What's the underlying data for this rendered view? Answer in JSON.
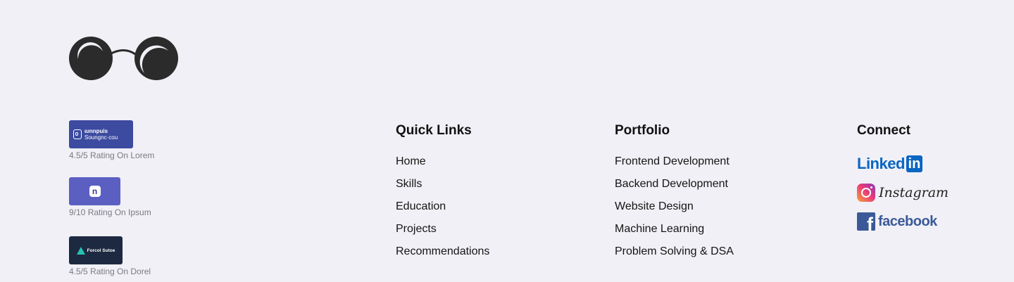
{
  "logo": {
    "icon": "sunglasses-icon"
  },
  "ratings": [
    {
      "badge_text_1": "ɩᴜnnpuis",
      "badge_text_2": "Soungnc·cou",
      "caption": "4.5/5 Rating On Lorem"
    },
    {
      "badge_letter": "n",
      "caption": "9/10 Rating On Ipsum"
    },
    {
      "badge_text": "Forcol Sutoe",
      "caption": "4.5/5 Rating On Dorel"
    }
  ],
  "quick_links": {
    "title": "Quick Links",
    "items": [
      "Home",
      "Skills",
      "Education",
      "Projects",
      "Recommendations"
    ]
  },
  "portfolio": {
    "title": "Portfolio",
    "items": [
      "Frontend Development",
      "Backend Development",
      "Website Design",
      "Machine Learning",
      "Problem Solving & DSA"
    ]
  },
  "connect": {
    "title": "Connect",
    "linkedin": {
      "text": "Linked",
      "box": "in",
      "color": "#0a66c2"
    },
    "instagram": {
      "text": "Instagram"
    },
    "facebook": {
      "letter": "f",
      "text": "facebook",
      "color": "#3b5998"
    }
  },
  "colors": {
    "background": "#f0f0f6"
  }
}
